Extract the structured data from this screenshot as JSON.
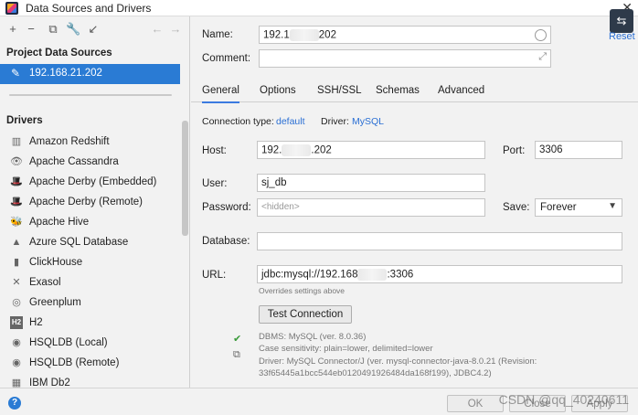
{
  "window": {
    "title": "Data Sources and Drivers",
    "close_glyph": "✕"
  },
  "left_panel": {
    "toolbar": [
      "+",
      "−",
      "⧉",
      "🔧",
      "↙",
      "←",
      "→"
    ],
    "project_section_title": "Project Data Sources",
    "selected_source": "192.168.21.202",
    "drivers_title": "Drivers",
    "drivers": [
      {
        "label": "Amazon Redshift",
        "icon": "redshift-icon",
        "glyph": "▥"
      },
      {
        "label": "Apache Cassandra",
        "icon": "cassandra-icon",
        "glyph": "👁"
      },
      {
        "label": "Apache Derby (Embedded)",
        "icon": "derby-icon",
        "glyph": "🎩"
      },
      {
        "label": "Apache Derby (Remote)",
        "icon": "derby-icon",
        "glyph": "🎩"
      },
      {
        "label": "Apache Hive",
        "icon": "hive-icon",
        "glyph": "🐝"
      },
      {
        "label": "Azure SQL Database",
        "icon": "azure-icon",
        "glyph": "▲"
      },
      {
        "label": "ClickHouse",
        "icon": "clickhouse-icon",
        "glyph": "▮"
      },
      {
        "label": "Exasol",
        "icon": "exasol-icon",
        "glyph": "✕"
      },
      {
        "label": "Greenplum",
        "icon": "greenplum-icon",
        "glyph": "◎"
      },
      {
        "label": "H2",
        "icon": "h2-icon",
        "glyph": "H2"
      },
      {
        "label": "HSQLDB (Local)",
        "icon": "hsqldb-icon",
        "glyph": "◉"
      },
      {
        "label": "HSQLDB (Remote)",
        "icon": "hsqldb-icon",
        "glyph": "◉"
      },
      {
        "label": "IBM Db2",
        "icon": "db2-icon",
        "glyph": "▦"
      }
    ]
  },
  "header": {
    "name_label": "Name:",
    "name_prefix": "192.1",
    "name_suffix": "202",
    "comment_label": "Comment:",
    "reset": "Reset"
  },
  "tabs": [
    "General",
    "Options",
    "SSH/SSL",
    "Schemas",
    "Advanced"
  ],
  "general": {
    "connection_type_label": "Connection type:",
    "connection_type_value": "default",
    "driver_label": "Driver:",
    "driver_value": "MySQL",
    "host_label": "Host:",
    "host_prefix": "192.",
    "host_suffix": ".202",
    "port_label": "Port:",
    "port_value": "3306",
    "user_label": "User:",
    "user_value": "sj_db",
    "password_label": "Password:",
    "password_placeholder": "<hidden>",
    "save_label": "Save:",
    "save_value": "Forever",
    "database_label": "Database:",
    "url_label": "URL:",
    "url_prefix": "jdbc:mysql://192.168",
    "url_suffix": ":3306",
    "url_hint": "Overrides settings above",
    "test_button": "Test Connection",
    "info_lines": [
      "DBMS: MySQL (ver. 8.0.36)",
      "Case sensitivity: plain=lower, delimited=lower",
      "Driver: MySQL Connector/J (ver. mysql-connector-java-8.0.21 (Revision:",
      "33f65445a1bcc544eb0120491926484da168f199), JDBC4.2)"
    ]
  },
  "footer": {
    "help": "?",
    "ok": "OK",
    "close": "Close",
    "apply": "Apply",
    "watermark": "CSDN @qq_40240611"
  }
}
